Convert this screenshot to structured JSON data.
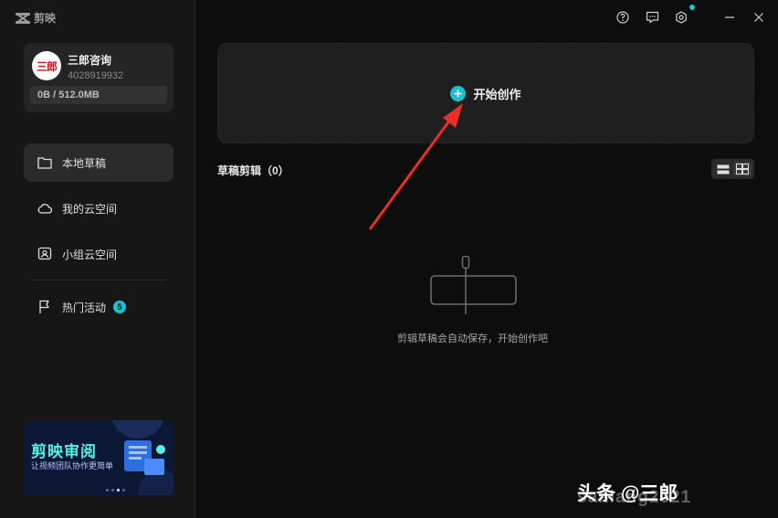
{
  "app": {
    "name": "剪映"
  },
  "user": {
    "avatar_text": "三郎",
    "name": "三郎咨询",
    "id": "4028919932",
    "storage": "0B / 512.0MB"
  },
  "sidebar": {
    "items": [
      {
        "label": "本地草稿",
        "icon": "folder-icon",
        "active": true
      },
      {
        "label": "我的云空间",
        "icon": "cloud-icon",
        "active": false
      },
      {
        "label": "小组云空间",
        "icon": "team-cloud-icon",
        "active": false
      },
      {
        "label": "热门活动",
        "icon": "flag-icon",
        "active": false,
        "badge": "5"
      }
    ]
  },
  "banner": {
    "title": "剪映审阅",
    "subtitle": "让视频团队协作更简单"
  },
  "topbar": {
    "icons": [
      "help-icon",
      "feedback-icon",
      "settings-icon",
      "minimize-icon",
      "close-icon"
    ]
  },
  "main": {
    "create_label": "开始创作",
    "drafts_title": "草稿剪辑（0）",
    "empty_text": "剪辑草稿会自动保存，开始创作吧"
  },
  "watermark": {
    "text": "头条 @三郎",
    "text2": "sanlang2021"
  },
  "colors": {
    "accent": "#19c2d2",
    "sidebar_bg": "#161616",
    "main_bg": "#0d0d0d",
    "arrow": "#e8302a"
  }
}
